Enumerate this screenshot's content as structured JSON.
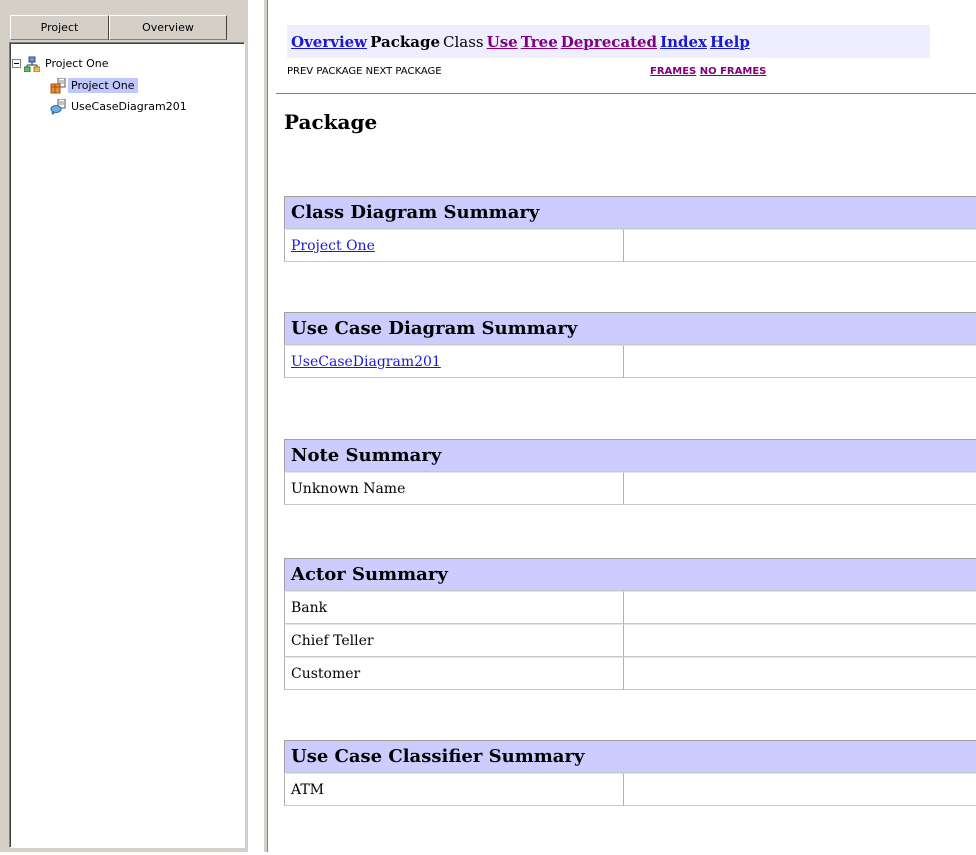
{
  "left_panel": {
    "tabs": [
      {
        "label": "Project"
      },
      {
        "label": "Overview"
      }
    ],
    "tree": {
      "root": {
        "label": "Project One",
        "icon": "model-icon"
      },
      "children": [
        {
          "label": "Project One",
          "icon": "class-diagram-icon",
          "selected": true
        },
        {
          "label": "UseCaseDiagram201",
          "icon": "use-case-diagram-icon",
          "selected": false
        }
      ]
    }
  },
  "navbar": {
    "overview": "Overview",
    "package": "Package",
    "class": "Class",
    "use": "Use",
    "tree": "Tree",
    "deprecated": "Deprecated",
    "index": "Index",
    "help": "Help"
  },
  "subnav": {
    "prev_next": "PREV PACKAGE  NEXT PACKAGE",
    "frames": "FRAMES",
    "no_frames": "NO FRAMES"
  },
  "page_title": "Package",
  "summaries": [
    {
      "title": "Class Diagram Summary",
      "rows": [
        {
          "name": "Project One",
          "link": true,
          "desc": ""
        }
      ]
    },
    {
      "title": "Use Case Diagram Summary",
      "rows": [
        {
          "name": "UseCaseDiagram201",
          "link": true,
          "desc": ""
        }
      ]
    },
    {
      "title": "Note Summary",
      "rows": [
        {
          "name": "Unknown Name",
          "link": false,
          "desc": ""
        }
      ]
    },
    {
      "title": "Actor Summary",
      "rows": [
        {
          "name": "Bank",
          "link": false,
          "desc": ""
        },
        {
          "name": "Chief Teller",
          "link": false,
          "desc": ""
        },
        {
          "name": "Customer",
          "link": false,
          "desc": ""
        }
      ]
    },
    {
      "title": "Use Case Classifier Summary",
      "rows": [
        {
          "name": "ATM",
          "link": false,
          "desc": ""
        }
      ]
    }
  ],
  "colors": {
    "link_visited": "#800080",
    "link_unvisited": "#1a1ad0",
    "table_header_bg": "#ccccff",
    "navbar_bg": "#eeeeff",
    "panel_bg": "#d4d0c8",
    "selection_bg": "#c0c8ff"
  }
}
